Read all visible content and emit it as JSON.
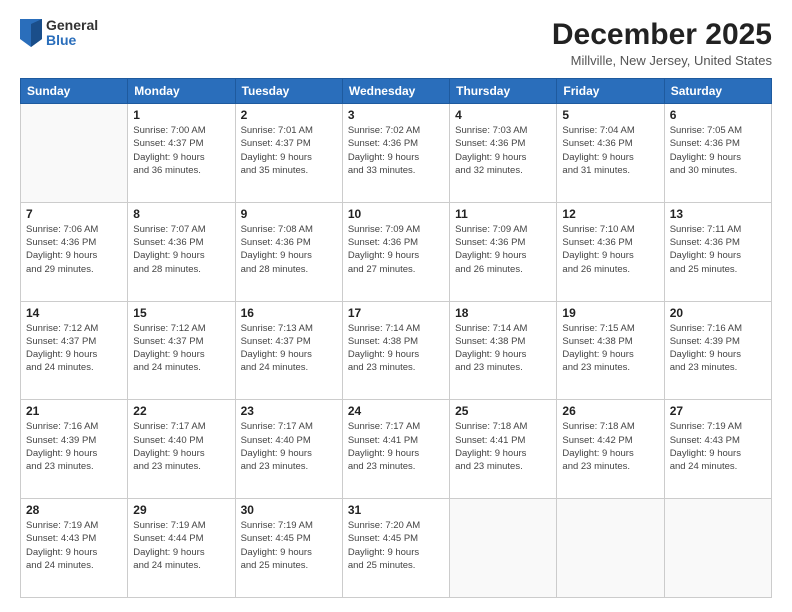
{
  "logo": {
    "general": "General",
    "blue": "Blue"
  },
  "title": "December 2025",
  "subtitle": "Millville, New Jersey, United States",
  "days_header": [
    "Sunday",
    "Monday",
    "Tuesday",
    "Wednesday",
    "Thursday",
    "Friday",
    "Saturday"
  ],
  "weeks": [
    [
      {
        "day": "",
        "info": ""
      },
      {
        "day": "1",
        "info": "Sunrise: 7:00 AM\nSunset: 4:37 PM\nDaylight: 9 hours\nand 36 minutes."
      },
      {
        "day": "2",
        "info": "Sunrise: 7:01 AM\nSunset: 4:37 PM\nDaylight: 9 hours\nand 35 minutes."
      },
      {
        "day": "3",
        "info": "Sunrise: 7:02 AM\nSunset: 4:36 PM\nDaylight: 9 hours\nand 33 minutes."
      },
      {
        "day": "4",
        "info": "Sunrise: 7:03 AM\nSunset: 4:36 PM\nDaylight: 9 hours\nand 32 minutes."
      },
      {
        "day": "5",
        "info": "Sunrise: 7:04 AM\nSunset: 4:36 PM\nDaylight: 9 hours\nand 31 minutes."
      },
      {
        "day": "6",
        "info": "Sunrise: 7:05 AM\nSunset: 4:36 PM\nDaylight: 9 hours\nand 30 minutes."
      }
    ],
    [
      {
        "day": "7",
        "info": "Sunrise: 7:06 AM\nSunset: 4:36 PM\nDaylight: 9 hours\nand 29 minutes."
      },
      {
        "day": "8",
        "info": "Sunrise: 7:07 AM\nSunset: 4:36 PM\nDaylight: 9 hours\nand 28 minutes."
      },
      {
        "day": "9",
        "info": "Sunrise: 7:08 AM\nSunset: 4:36 PM\nDaylight: 9 hours\nand 28 minutes."
      },
      {
        "day": "10",
        "info": "Sunrise: 7:09 AM\nSunset: 4:36 PM\nDaylight: 9 hours\nand 27 minutes."
      },
      {
        "day": "11",
        "info": "Sunrise: 7:09 AM\nSunset: 4:36 PM\nDaylight: 9 hours\nand 26 minutes."
      },
      {
        "day": "12",
        "info": "Sunrise: 7:10 AM\nSunset: 4:36 PM\nDaylight: 9 hours\nand 26 minutes."
      },
      {
        "day": "13",
        "info": "Sunrise: 7:11 AM\nSunset: 4:36 PM\nDaylight: 9 hours\nand 25 minutes."
      }
    ],
    [
      {
        "day": "14",
        "info": "Sunrise: 7:12 AM\nSunset: 4:37 PM\nDaylight: 9 hours\nand 24 minutes."
      },
      {
        "day": "15",
        "info": "Sunrise: 7:12 AM\nSunset: 4:37 PM\nDaylight: 9 hours\nand 24 minutes."
      },
      {
        "day": "16",
        "info": "Sunrise: 7:13 AM\nSunset: 4:37 PM\nDaylight: 9 hours\nand 24 minutes."
      },
      {
        "day": "17",
        "info": "Sunrise: 7:14 AM\nSunset: 4:38 PM\nDaylight: 9 hours\nand 23 minutes."
      },
      {
        "day": "18",
        "info": "Sunrise: 7:14 AM\nSunset: 4:38 PM\nDaylight: 9 hours\nand 23 minutes."
      },
      {
        "day": "19",
        "info": "Sunrise: 7:15 AM\nSunset: 4:38 PM\nDaylight: 9 hours\nand 23 minutes."
      },
      {
        "day": "20",
        "info": "Sunrise: 7:16 AM\nSunset: 4:39 PM\nDaylight: 9 hours\nand 23 minutes."
      }
    ],
    [
      {
        "day": "21",
        "info": "Sunrise: 7:16 AM\nSunset: 4:39 PM\nDaylight: 9 hours\nand 23 minutes."
      },
      {
        "day": "22",
        "info": "Sunrise: 7:17 AM\nSunset: 4:40 PM\nDaylight: 9 hours\nand 23 minutes."
      },
      {
        "day": "23",
        "info": "Sunrise: 7:17 AM\nSunset: 4:40 PM\nDaylight: 9 hours\nand 23 minutes."
      },
      {
        "day": "24",
        "info": "Sunrise: 7:17 AM\nSunset: 4:41 PM\nDaylight: 9 hours\nand 23 minutes."
      },
      {
        "day": "25",
        "info": "Sunrise: 7:18 AM\nSunset: 4:41 PM\nDaylight: 9 hours\nand 23 minutes."
      },
      {
        "day": "26",
        "info": "Sunrise: 7:18 AM\nSunset: 4:42 PM\nDaylight: 9 hours\nand 23 minutes."
      },
      {
        "day": "27",
        "info": "Sunrise: 7:19 AM\nSunset: 4:43 PM\nDaylight: 9 hours\nand 24 minutes."
      }
    ],
    [
      {
        "day": "28",
        "info": "Sunrise: 7:19 AM\nSunset: 4:43 PM\nDaylight: 9 hours\nand 24 minutes."
      },
      {
        "day": "29",
        "info": "Sunrise: 7:19 AM\nSunset: 4:44 PM\nDaylight: 9 hours\nand 24 minutes."
      },
      {
        "day": "30",
        "info": "Sunrise: 7:19 AM\nSunset: 4:45 PM\nDaylight: 9 hours\nand 25 minutes."
      },
      {
        "day": "31",
        "info": "Sunrise: 7:20 AM\nSunset: 4:45 PM\nDaylight: 9 hours\nand 25 minutes."
      },
      {
        "day": "",
        "info": ""
      },
      {
        "day": "",
        "info": ""
      },
      {
        "day": "",
        "info": ""
      }
    ]
  ]
}
